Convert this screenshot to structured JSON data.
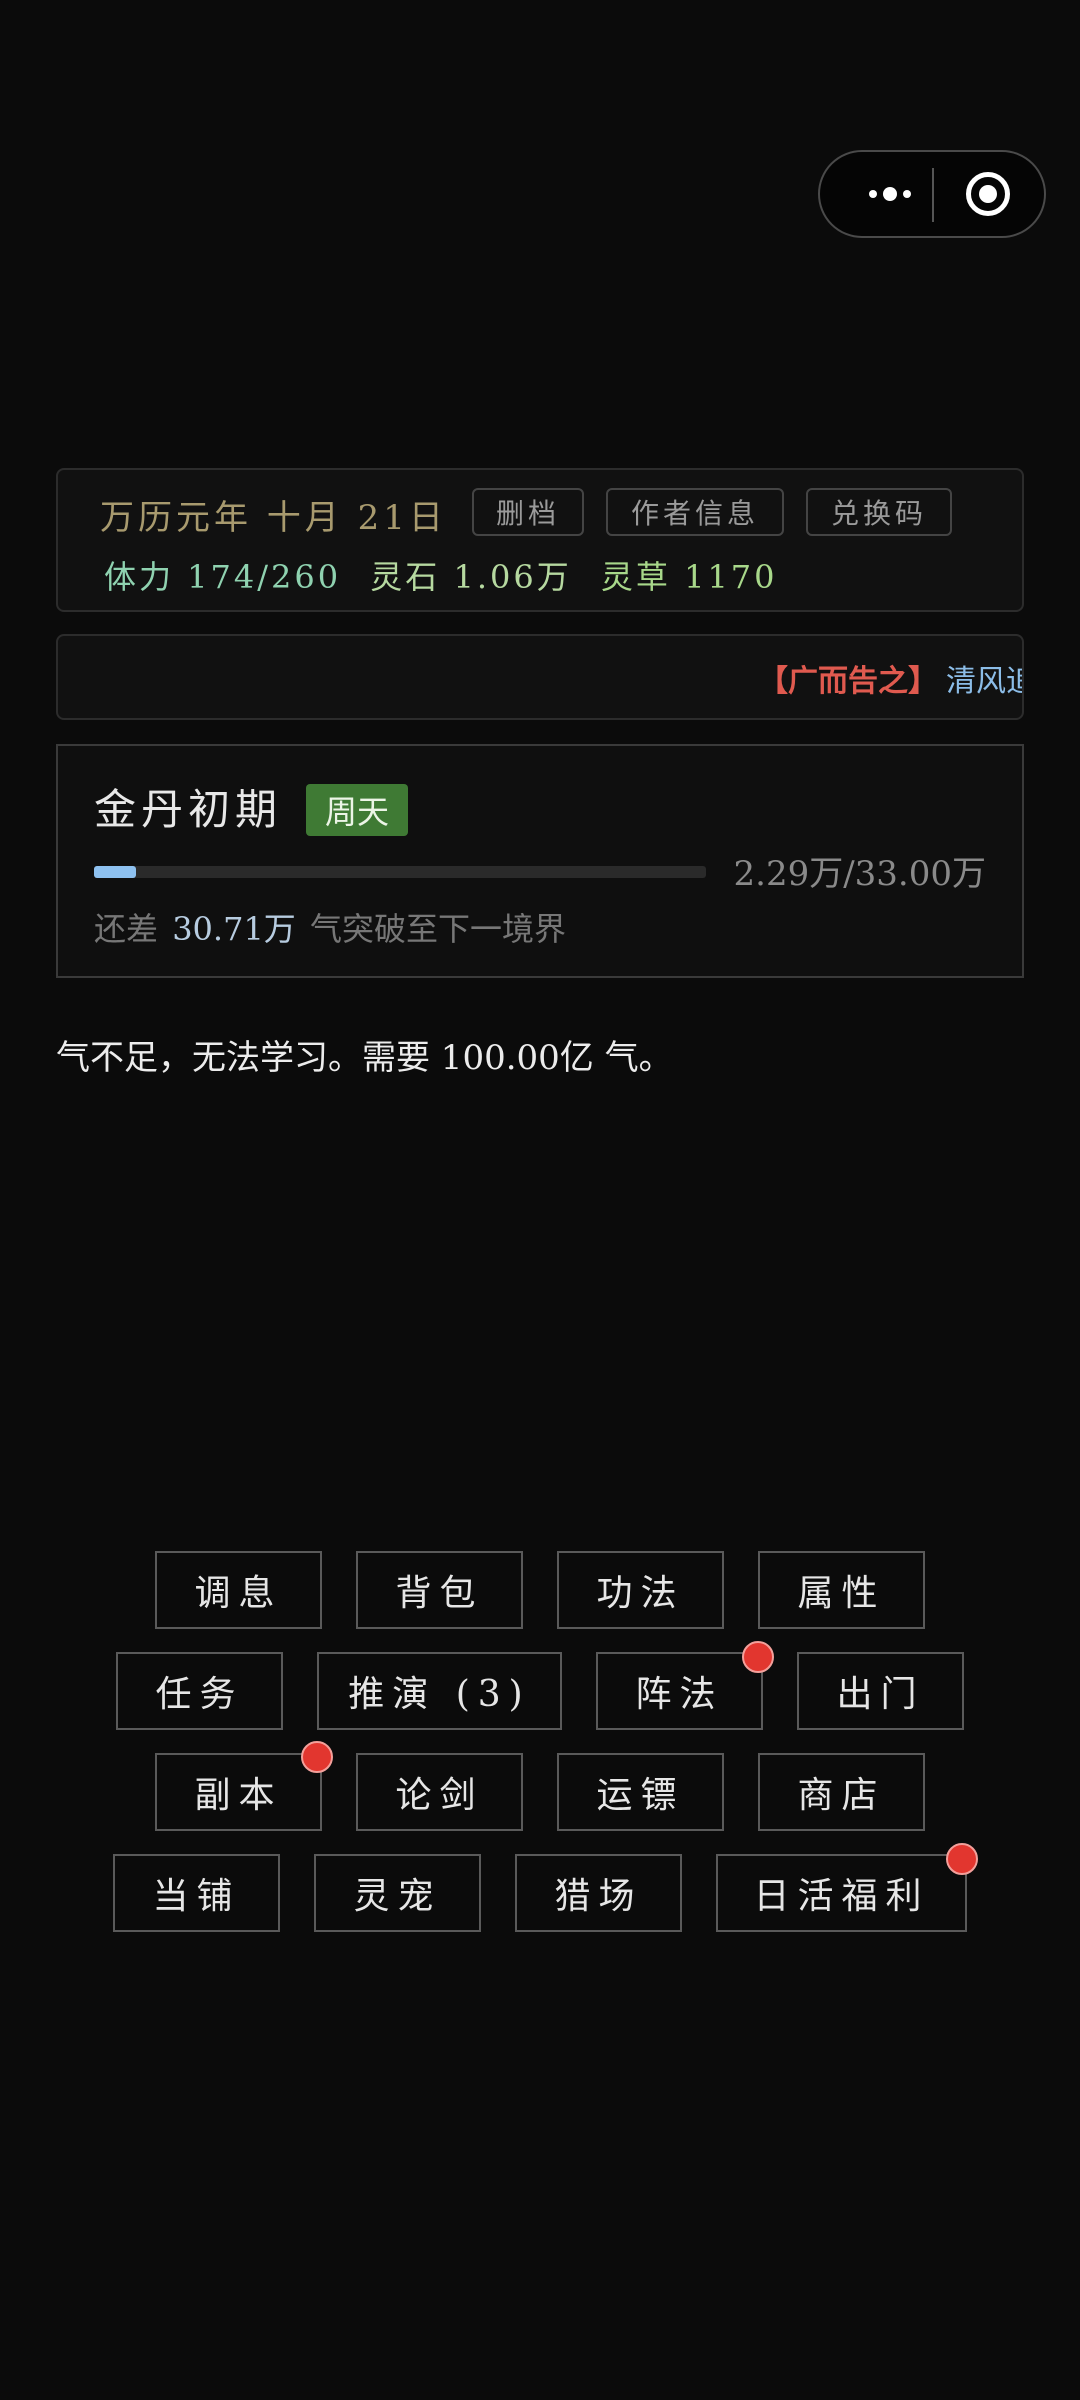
{
  "status": {
    "date": "万历元年 十月 21日",
    "buttons": {
      "delete_save": "删档",
      "author_info": "作者信息",
      "redeem_code": "兑换码"
    },
    "stamina": "体力 174/260",
    "spirit_stone": "灵石 1.06万",
    "spirit_herb": "灵草 1170"
  },
  "announcement": {
    "tag": "【广而告之】",
    "text": "清风追"
  },
  "realm": {
    "name": "金丹初期",
    "badge": "周天",
    "progress_text": "2.29万/33.00万",
    "progress_fraction": 0.0694,
    "hint_prefix": "还差",
    "hint_amount": "30.71万",
    "hint_suffix": "气突破至下一境界"
  },
  "message": "气不足，无法学习。需要 100.00亿 气。",
  "actions": {
    "rest": "调息",
    "bag": "背包",
    "skills": "功法",
    "attributes": "属性",
    "tasks": "任务",
    "deduce": "推演 (3)",
    "formation": "阵法",
    "go_out": "出门",
    "dungeon": "副本",
    "sword_duel": "论剑",
    "escort": "运镖",
    "shop": "商店",
    "pawnshop": "当铺",
    "pet": "灵宠",
    "hunting": "猎场",
    "daily_welfare": "日活福利"
  },
  "colors": {
    "background": "#0b0b0b",
    "badge_green": "#3f7a34",
    "progress_blue": "#8ec1f0",
    "notification_red": "#e2362f",
    "announce_tag_red": "#e05a4f"
  }
}
